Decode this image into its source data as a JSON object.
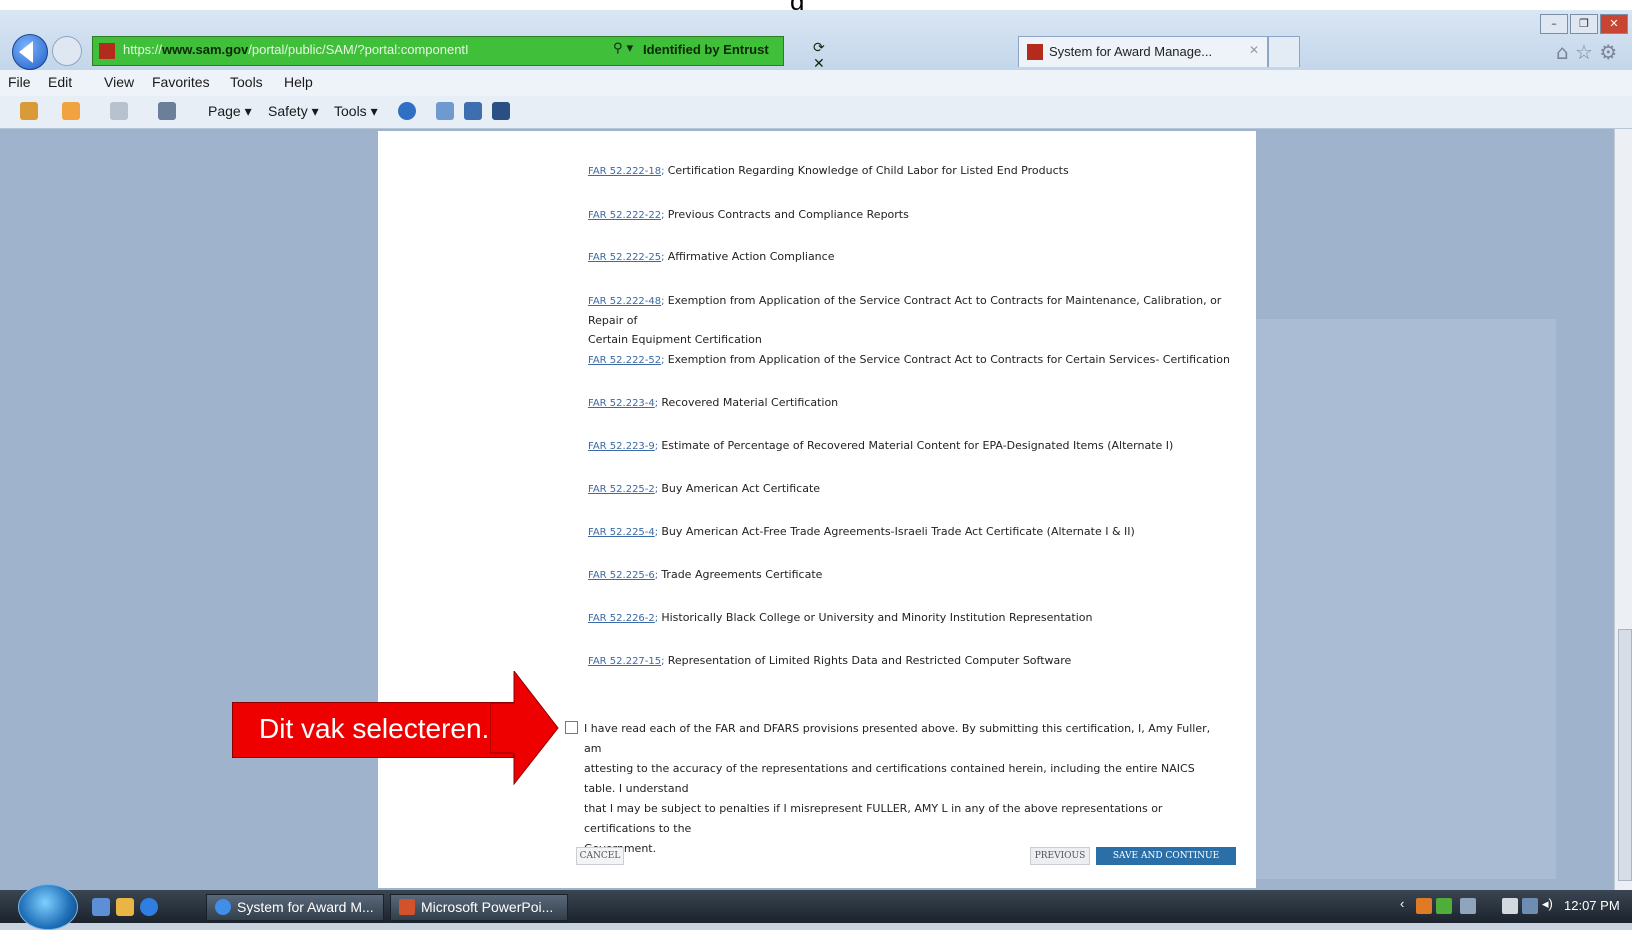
{
  "slide_title_fragment": "g",
  "browser": {
    "url_prefix": "https://",
    "url_domain": "www.sam.gov",
    "url_path": "/portal/public/SAM/?portal:componentI",
    "search_ctrl": "⚲ ▾",
    "identity": "Identified by Entrust",
    "addr_tail": "⟳ ✕",
    "tab_title": "System for Award Manage...",
    "tab_close": "✕",
    "window_controls": [
      "–",
      "❐",
      "✕"
    ],
    "right_icons": "⌂ ☆ ⚙"
  },
  "menu": [
    "File",
    "Edit",
    "View",
    "Favorites",
    "Tools",
    "Help"
  ],
  "commandbar": {
    "page": "Page ▾",
    "safety": "Safety ▾",
    "tools": "Tools ▾"
  },
  "certifications": [
    {
      "code": "FAR 52.222-18",
      "text": "Certification Regarding Knowledge of Child Labor for Listed End Products"
    },
    {
      "code": "FAR 52.222-22",
      "text": "Previous Contracts and Compliance Reports"
    },
    {
      "code": "FAR 52.222-25",
      "text": "Affirmative Action Compliance"
    },
    {
      "code": "FAR 52.222-48",
      "text": "Exemption from Application of the Service Contract Act to Contracts for Maintenance, Calibration, or Repair of",
      "text2": "Certain Equipment Certification"
    },
    {
      "code": "FAR 52.222-52",
      "text": "Exemption from Application of the Service Contract Act to Contracts for Certain Services- Certification"
    },
    {
      "code": "FAR 52.223-4",
      "text": "Recovered Material Certification"
    },
    {
      "code": "FAR 52.223-9",
      "text": "Estimate of Percentage of Recovered Material Content for EPA-Designated Items (Alternate I)"
    },
    {
      "code": "FAR 52.225-2",
      "text": "Buy American Act Certificate"
    },
    {
      "code": "FAR 52.225-4",
      "text": "Buy American Act-Free Trade Agreements-Israeli Trade Act Certificate (Alternate I & II)"
    },
    {
      "code": "FAR 52.225-6",
      "text": "Trade Agreements Certificate"
    },
    {
      "code": "FAR 52.226-2",
      "text": "Historically Black College or University and Minority Institution Representation"
    },
    {
      "code": "FAR 52.227-15",
      "text": "Representation of Limited Rights Data and Restricted Computer Software"
    }
  ],
  "attestation": {
    "line1": "I have read each of the FAR and DFARS provisions presented above. By submitting this certification, I,  Amy Fuller, am",
    "line2": "attesting to the accuracy of the representations and certifications contained herein, including the entire NAICS table. I understand",
    "line3": "that I may be subject to penalties if I misrepresent  FULLER, AMY L in any of the above representations or certifications to the",
    "line4": "Government."
  },
  "buttons": {
    "cancel": "CANCEL",
    "previous": "PREVIOUS",
    "save_continue": "SAVE AND CONTINUE"
  },
  "callout": {
    "text": "Dit vak selecteren."
  },
  "taskbar": {
    "ie_window": "System for Award M...",
    "ppt_window": "Microsoft PowerPoi...",
    "clock": "12:07 PM"
  },
  "colors": {
    "link": "#3b6aa6",
    "callout": "#ee0000",
    "address_bar": "#3fbf3a",
    "primary_button": "#2a6fa8"
  }
}
